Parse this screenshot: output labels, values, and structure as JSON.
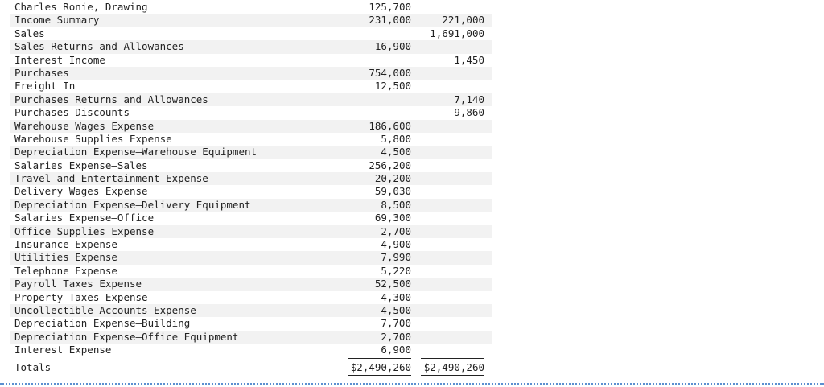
{
  "rows": [
    {
      "account": "Charles Ronie, Drawing",
      "debit": "125,700",
      "credit": ""
    },
    {
      "account": "Income Summary",
      "debit": "231,000",
      "credit": "221,000"
    },
    {
      "account": "Sales",
      "debit": "",
      "credit": "1,691,000"
    },
    {
      "account": "Sales Returns and Allowances",
      "debit": "16,900",
      "credit": ""
    },
    {
      "account": "Interest Income",
      "debit": "",
      "credit": "1,450"
    },
    {
      "account": "Purchases",
      "debit": "754,000",
      "credit": ""
    },
    {
      "account": "Freight In",
      "debit": "12,500",
      "credit": ""
    },
    {
      "account": "Purchases Returns and Allowances",
      "debit": "",
      "credit": "7,140"
    },
    {
      "account": "Purchases Discounts",
      "debit": "",
      "credit": "9,860"
    },
    {
      "account": "Warehouse Wages Expense",
      "debit": "186,600",
      "credit": ""
    },
    {
      "account": "Warehouse Supplies Expense",
      "debit": "5,800",
      "credit": ""
    },
    {
      "account": "Depreciation Expense—Warehouse Equipment",
      "debit": "4,500",
      "credit": ""
    },
    {
      "account": "Salaries Expense—Sales",
      "debit": "256,200",
      "credit": ""
    },
    {
      "account": "Travel and Entertainment Expense",
      "debit": "20,200",
      "credit": ""
    },
    {
      "account": "Delivery Wages Expense",
      "debit": "59,030",
      "credit": ""
    },
    {
      "account": "Depreciation Expense—Delivery Equipment",
      "debit": "8,500",
      "credit": ""
    },
    {
      "account": "Salaries Expense—Office",
      "debit": "69,300",
      "credit": ""
    },
    {
      "account": "Office Supplies Expense",
      "debit": "2,700",
      "credit": ""
    },
    {
      "account": "Insurance Expense",
      "debit": "4,900",
      "credit": ""
    },
    {
      "account": "Utilities Expense",
      "debit": "7,990",
      "credit": ""
    },
    {
      "account": "Telephone Expense",
      "debit": "5,220",
      "credit": ""
    },
    {
      "account": "Payroll Taxes Expense",
      "debit": "52,500",
      "credit": ""
    },
    {
      "account": "Property Taxes Expense",
      "debit": "4,300",
      "credit": ""
    },
    {
      "account": "Uncollectible Accounts Expense",
      "debit": "4,500",
      "credit": ""
    },
    {
      "account": "Depreciation Expense—Building",
      "debit": "7,700",
      "credit": ""
    },
    {
      "account": "Depreciation Expense—Office Equipment",
      "debit": "2,700",
      "credit": ""
    },
    {
      "account": "Interest Expense",
      "debit": "6,900",
      "credit": ""
    }
  ],
  "totals": {
    "label": "Totals",
    "debit": "$2,490,260",
    "credit": "$2,490,260"
  }
}
